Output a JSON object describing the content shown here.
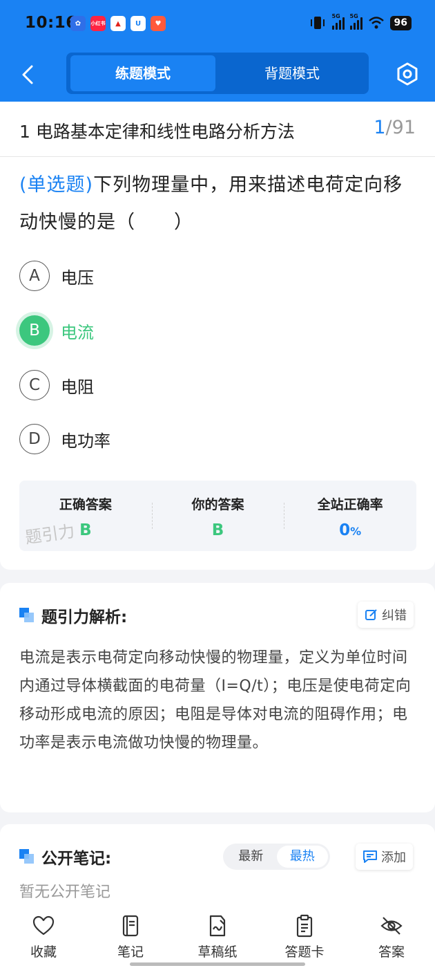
{
  "status": {
    "time": "10:16",
    "apps": [
      "小红书"
    ],
    "signal1": "5G",
    "signal2": "5G",
    "battery": "96"
  },
  "header": {
    "mode_practice": "练题模式",
    "mode_recite": "背题模式"
  },
  "chapter": {
    "title": "1 电路基本定律和线性电路分析方法",
    "current": "1",
    "total": "/91"
  },
  "question": {
    "type": "(单选题)",
    "text": "下列物理量中，用来描述电荷定向移动快慢的是（　　）",
    "options": [
      {
        "letter": "A",
        "text": "电压"
      },
      {
        "letter": "B",
        "text": "电流"
      },
      {
        "letter": "C",
        "text": "电阻"
      },
      {
        "letter": "D",
        "text": "电功率"
      }
    ],
    "selected": "B"
  },
  "stats": {
    "correct_label": "正确答案",
    "correct_value": "B",
    "yours_label": "你的答案",
    "yours_value": "B",
    "rate_label": "全站正确率",
    "rate_value": "0",
    "rate_unit": "%",
    "watermark": "题引力"
  },
  "analysis": {
    "title": "题引力解析:",
    "report_label": "纠错",
    "body": "电流是表示电荷定向移动快慢的物理量，定义为单位时间内通过导体横截面的电荷量（I=Q/t）；电压是使电荷定向移动形成电流的原因；电阻是导体对电流的阻碍作用；电功率是表示电流做功快慢的物理量。"
  },
  "notes": {
    "title": "公开笔记:",
    "tab_new": "最新",
    "tab_hot": "最热",
    "add_label": "添加",
    "empty": "暂无公开笔记"
  },
  "bottom": {
    "favorite": "收藏",
    "note": "笔记",
    "draft": "草稿纸",
    "card": "答题卡",
    "answer": "答案"
  },
  "colors": {
    "primary": "#1a82f3",
    "correct": "#3cc77e"
  }
}
